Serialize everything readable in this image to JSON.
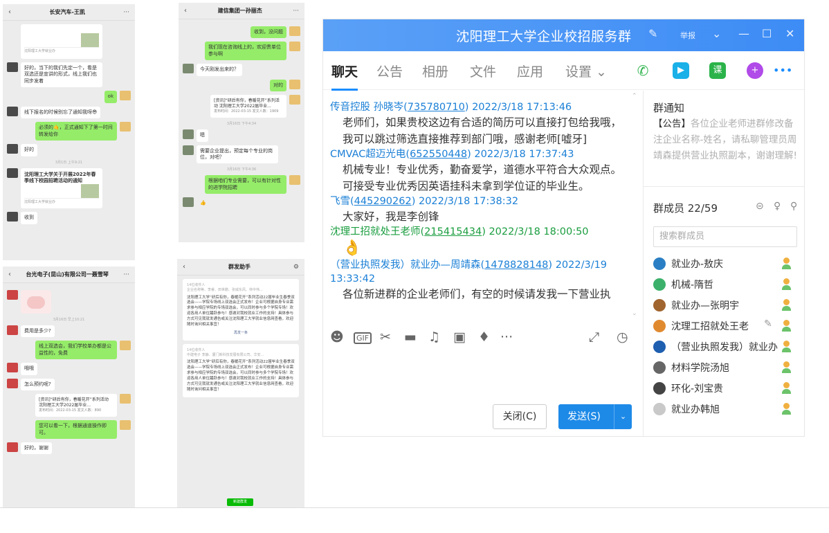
{
  "phones": {
    "p1": {
      "title": "长安汽车-王凯",
      "messages": [
        {
          "card_source": "沈阳理工大学就业办"
        },
        {
          "text": "好的，当下的我们先定一个，看是双选还是宣讲的形式，线上我们也同步发着"
        },
        {
          "text": "ok"
        },
        {
          "text": "线下报名的时候别忘了通知我呀😎"
        },
        {
          "text": "必须的🤙，正式通知下了第一时间转发给你"
        },
        {
          "text": "好的"
        },
        {
          "time": "3月1日 上午9:21"
        },
        {
          "card": "沈阳理工大学关于开展2022年春季线下校园招聘活动的通知",
          "card_source": "沈阳理工大学就业办"
        },
        {
          "text": "收到"
        }
      ]
    },
    "p2": {
      "title": "建信集团一孙丽杰",
      "messages": [
        {
          "text": "收到，没问题"
        },
        {
          "text": "我们现在咨询线上的，欢迎贵单位参与啊"
        },
        {
          "text": "今天刚发出来的？"
        },
        {
          "text": "对的"
        },
        {
          "card": "[资讯]“研后有你，春暖花开”系列活动 沈阳理工大学2022届毕业...",
          "sub": "发布时间：2022-03-15  发文人数：1909"
        },
        {
          "time": "3月16日 下午4:34"
        },
        {
          "text": "嗯"
        },
        {
          "text": "需要企业提出，预定每个专业的岗位，对吧？"
        },
        {
          "time": "3月16日 下午4:36"
        },
        {
          "text": "根据咱们专业需要，可以有针对性的进学院招聘"
        },
        {
          "text": "👍"
        }
      ]
    },
    "p3": {
      "title": "台光电子(昆山)有限公司一聂雪琴",
      "messages": [
        {
          "time": "3月16日 早上10:21"
        },
        {
          "text": "费用是多少?"
        },
        {
          "text": "线上双选会，我们学校单办都是公益性的，免费"
        },
        {
          "text": "哦哦"
        },
        {
          "text": "怎么预约呢?"
        },
        {
          "card": "[资讯]“研后有你，春暖花开”系列活动 沈阳理工大学2022届毕业...",
          "sub": "发布时间：2022-03-15  发文人数：890"
        },
        {
          "text": "您可以看一下，根据通道操作即可。"
        },
        {
          "text": "好的，谢谢"
        }
      ]
    },
    "p4": {
      "title": "群发助手",
      "cards": [
        {
          "meta": "14位收件人",
          "names": "企业名称等、李睿、田世鹏、张威东风、林中伟...",
          "body": "沈阳理工大学“研后有你，春暖花开”系列活动22届毕业生春季双选会——学院专场线上双选会正式发布！企业可根据自身专业需求参与相应学院的专场双选会，可以同时参与多个学院专场！欢迎各用人单位踊跃参与！感谢对我校就业工作的支持！具体参与方式可见我就发通告或关注沈阳理工大学就业信息网查看，欢迎随时询问相关事宜！",
          "link": "再发一条"
        },
        {
          "meta": "14位收件人",
          "names": "中建电子 李静、厦门新科技发展有限公司、华安...",
          "body": "沈阳理工大学“研后有你，春暖花开”系列活动22届毕业生春季双选会——学院专场线上双选会正式发布！企业可根据自身专业需求参与相应学院的专场双选会，可以同时参与多个学院专场！欢迎各用人单位踊跃参与！感谢对我校就业工作的支持！具体参与方式可见我就发通告或关注沈阳理工大学就业信息网查看，欢迎随时询问相关事宜！"
        }
      ],
      "button": "新建群发"
    }
  },
  "qq": {
    "title": "沈阳理工大学企业校招服务群",
    "report": "举报",
    "tabs": [
      "聊天",
      "公告",
      "相册",
      "文件",
      "应用",
      "设置 ⌄"
    ],
    "messages": [
      {
        "sender": "传音控股 孙晓岑(",
        "id": "735780710",
        "time": ") 2022/3/18 17:13:46",
        "lines": [
          "老师们，如果贵校这边有合适的简历可以直接打包给我哦，",
          "我可以跳过筛选直接推荐到部门哦，感谢老师[嘘牙]"
        ]
      },
      {
        "sender": "CMVAC超迈光电(",
        "id": "652550448",
        "time": ") 2022/3/18 17:37:43",
        "lines": [
          "机械专业！专业优秀，勤奋爱学，道德水平符合大众观点。",
          "可接受专业优秀因英语挂科未拿到学位证的毕业生。"
        ]
      },
      {
        "sender": "飞雪(",
        "id": "445290262",
        "time": ") 2022/3/18 17:38:32",
        "lines": [
          "大家好，我是李创锋"
        ]
      },
      {
        "sender": "沈理工招就处王老师(",
        "id": "215415434",
        "time": ") 2022/3/18 18:00:50",
        "emoji": "👌",
        "green": true
      },
      {
        "sender": "（营业执照发我）就业办—周靖森(",
        "id": "1478828148",
        "time": ") 2022/3/19",
        "time2": "13:33:42",
        "lines": [
          "各位新进群的企业老师们，有空的时候请发我一下营业执"
        ]
      }
    ],
    "buttons": {
      "close": "关闭(C)",
      "send": "发送(S)"
    },
    "notice": {
      "title": "群通知",
      "tag": "【公告】",
      "text": "各位企业老师进群修改备注企业名称-姓名，请私聊管理员周靖森提供营业执照副本，谢谢理解!"
    },
    "members": {
      "title": "群成员 22/59",
      "search_placeholder": "搜索群成员",
      "list": [
        "就业办-敖庆",
        "机械-隋哲",
        "就业办—张明宇",
        "沈理工招就处王老",
        "（营业执照发我）就业办",
        "材料学院汤旭",
        "环化-刘宝贵",
        "就业办韩旭"
      ]
    },
    "colors": {
      "title_bar": "#3d8cf5",
      "accent": "#1a8cff",
      "send": "#1e8ae8"
    }
  }
}
